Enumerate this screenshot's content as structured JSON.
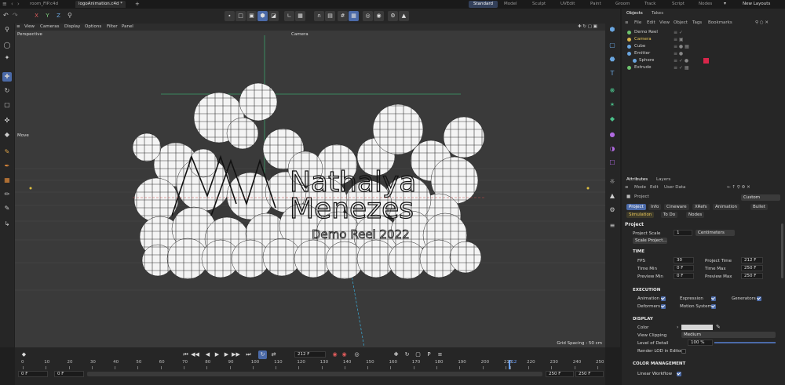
{
  "window": {
    "doc_tabs": [
      "room_FIP.c4d",
      "logoAnimation.c4d *"
    ],
    "add_tab": "+",
    "layouts": [
      "Standard",
      "Model",
      "Sculpt",
      "UVEdit",
      "Paint",
      "Groom",
      "Track",
      "Script",
      "Nodes"
    ],
    "active_layout": "Standard",
    "new_layouts": "New Layouts"
  },
  "toolbar": {
    "axis_x": "X",
    "axis_y": "Y",
    "axis_z": "Z"
  },
  "viewport": {
    "menu": [
      "View",
      "Cameras",
      "Display",
      "Options",
      "Filter",
      "Panel"
    ],
    "view_name": "Perspective",
    "camera_label": "Camera",
    "tool_hint": "Move",
    "logo_line1": "Nathalya",
    "logo_line2": "Menezes",
    "logo_line3": "Demo Reel 2022",
    "grid_spacing": "Grid Spacing : 50 cm"
  },
  "objects_panel": {
    "tabs": [
      "Objects",
      "Takes"
    ],
    "menu": [
      "File",
      "Edit",
      "View",
      "Object",
      "Tags",
      "Bookmarks"
    ],
    "items": [
      {
        "name": "Demo Reel",
        "color": "#cfcfcf",
        "icon_color": "#6ec36e"
      },
      {
        "name": "Camera",
        "color": "#e8c65a",
        "icon_color": "#d9b34a"
      },
      {
        "name": "Cube",
        "color": "#cfcfcf",
        "icon_color": "#6aa6e0"
      },
      {
        "name": "Emitter",
        "color": "#cfcfcf",
        "icon_color": "#6aa6e0"
      },
      {
        "name": "Sphere",
        "color": "#cfcfcf",
        "icon_color": "#6aa6e0"
      },
      {
        "name": "Extrude",
        "color": "#cfcfcf",
        "icon_color": "#6ec36e"
      }
    ]
  },
  "attributes_panel": {
    "tabs": [
      "Attributes",
      "Layers"
    ],
    "menu": [
      "Mode",
      "Edit",
      "User Data"
    ],
    "object_label": "Project",
    "preset": "Custom",
    "subtabs_row1": [
      "Project",
      "Info",
      "Cineware",
      "XRefs",
      "Animation",
      "Bullet"
    ],
    "subtabs_row2": [
      "Simulation",
      "To Do",
      "Nodes"
    ],
    "section_project": "Project",
    "project_scale_label": "Project Scale",
    "project_scale_value": "1",
    "project_scale_unit": "Centimeters",
    "scale_project_button": "Scale Project...",
    "section_time": "TIME",
    "fps_label": "FPS",
    "fps_value": "30",
    "project_time_label": "Project Time",
    "project_time_value": "212 F",
    "time_min_label": "Time Min",
    "time_min_value": "0 F",
    "time_max_label": "Time Max",
    "time_max_value": "250 F",
    "preview_min_label": "Preview Min",
    "preview_min_value": "0 F",
    "preview_max_label": "Preview Max",
    "preview_max_value": "250 F",
    "section_execution": "EXECUTION",
    "animation_label": "Animation",
    "expression_label": "Expression",
    "generators_label": "Generators",
    "deformers_label": "Deformers",
    "motion_system_label": "Motion System",
    "section_display": "DISPLAY",
    "color_label": "Color",
    "view_clipping_label": "View Clipping",
    "view_clipping_value": "Medium",
    "lod_label": "Level of Detail",
    "lod_value": "100 %",
    "lod_fraction": 1.0,
    "render_lod_label": "Render LOD in Editor",
    "section_color_mgmt": "COLOR MANAGEMENT",
    "linear_workflow_label": "Linear Workflow"
  },
  "timeline": {
    "current_frame": "212 F",
    "ruler_labels": [
      "0",
      "10",
      "20",
      "30",
      "40",
      "50",
      "60",
      "70",
      "80",
      "90",
      "100",
      "110",
      "120",
      "130",
      "140",
      "150",
      "160",
      "170",
      "180",
      "190",
      "200",
      "210",
      "212",
      "220",
      "230",
      "240",
      "250"
    ],
    "playhead_frame": 212,
    "start_field": "0 F",
    "start_field2": "0 F",
    "end_field": "250 F",
    "end_field2": "250 F"
  },
  "colors": {
    "accent": "#4b6aa8",
    "sphere_swatch": "#d8264a",
    "playhead": "#6aa0ff"
  }
}
